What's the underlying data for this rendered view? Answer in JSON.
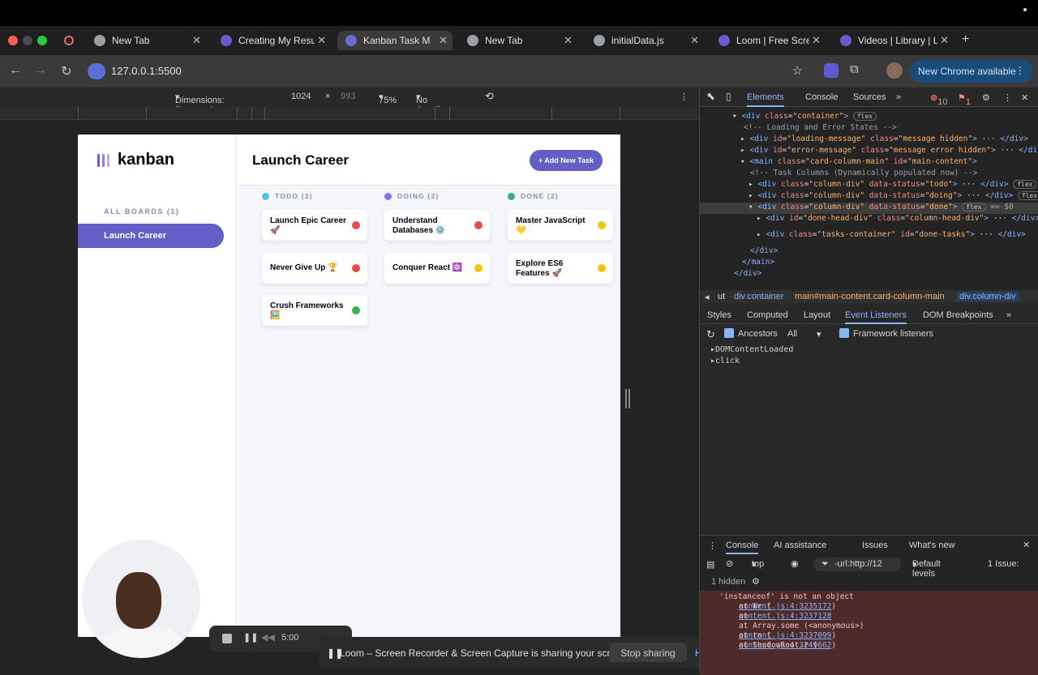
{
  "tabs": [
    {
      "label": "New Tab"
    },
    {
      "label": "Creating My Resu"
    },
    {
      "label": "Kanban Task M"
    },
    {
      "label": "New Tab"
    },
    {
      "label": "initialData.js"
    },
    {
      "label": "Loom | Free Scree"
    },
    {
      "label": "Videos | Library | L"
    }
  ],
  "address": {
    "url": "127.0.0.1:5500"
  },
  "new_chrome": "New Chrome available",
  "device_toolbar": {
    "dimensions": "Dimensions: Responsive",
    "width": "1024",
    "height": "993",
    "zoom": "75%",
    "throttle": "No throttling"
  },
  "app": {
    "logo": "kanban",
    "boards_label": "ALL BOARDS (1)",
    "board": "Launch Career",
    "title": "Launch Career",
    "add_button": "+ Add New Task",
    "columns": [
      {
        "label": "TODO (3)",
        "color": "#49c4e5",
        "cards": [
          {
            "title": "Launch Epic Career 🚀",
            "priority": "#e84b4b"
          },
          {
            "title": "Never Give Up 🏆",
            "priority": "#e84b4b"
          },
          {
            "title": "Crush Frameworks 🖼️",
            "priority": "#3bb54a"
          }
        ]
      },
      {
        "label": "DOING (2)",
        "color": "#8471f2",
        "cards": [
          {
            "title": "Understand Databases ⚙️",
            "priority": "#e84b4b"
          },
          {
            "title": "Conquer React ⚛️",
            "priority": "#f2c40f"
          }
        ]
      },
      {
        "label": "DONE (2)",
        "color": "#35a88f",
        "cards": [
          {
            "title": "Master JavaScript 💛",
            "priority": "#f2c40f"
          },
          {
            "title": "Explore ES6 Features 🚀",
            "priority": "#f2c40f"
          }
        ]
      }
    ]
  },
  "loom": {
    "timer": "5:00",
    "message": "Loom – Screen Recorder & Screen Capture is sharing your screen.",
    "stop": "Stop sharing",
    "hide": "Hide"
  },
  "devtools": {
    "tabs": [
      "Elements",
      "Console",
      "Sources"
    ],
    "errors": "10",
    "warnings": "1",
    "dom_lines": [
      {
        "text": "<div class=\"container\">",
        "badge": "flex"
      },
      {
        "text": "<!-- Loading and Error States -->"
      },
      {
        "text": "<div id=\"loading-message\" class=\"message hidden\"> ··· </div>"
      },
      {
        "text": "<div id=\"error-message\" class=\"message error hidden\"> ··· </div>"
      },
      {
        "text": "<main class=\"card-column-main\" id=\"main-content\">"
      },
      {
        "text": "<!-- Task Columns (Dynamically populated now) -->"
      },
      {
        "text": "<div class=\"column-div\" data-status=\"todo\"> ··· </div>",
        "badge": "flex"
      },
      {
        "text": "<div class=\"column-div\" data-status=\"doing\"> ··· </div>",
        "badge": "flex"
      },
      {
        "text": "<div class=\"column-div\" data-status=\"done\">",
        "badge": "flex",
        "suffix": "== $0"
      },
      {
        "text": "<div id=\"done-head-div\" class=\"column-head-div\"> ··· </div>"
      },
      {
        "text": "<div class=\"tasks-container\" id=\"done-tasks\"> ··· </div>"
      },
      {
        "text": "</div>"
      },
      {
        "text": "</main>"
      },
      {
        "text": "</div>"
      }
    ],
    "breadcrumbs": [
      "ut",
      "div.container",
      "main#main-content.card-column-main",
      "div.column-div"
    ],
    "subtabs": [
      "Styles",
      "Computed",
      "Layout",
      "Event Listeners",
      "DOM Breakpoints"
    ],
    "ancestors": "Ancestors",
    "filter": "All",
    "framework": "Framework listeners",
    "events": [
      "DOMContentLoaded",
      "click"
    ],
    "console": {
      "tabs": [
        "Console",
        "AI assistance",
        "Issues",
        "What's new"
      ],
      "context": "top",
      "filter": "-url:http://12",
      "levels": "Default levels",
      "issues": "1 Issue:",
      "hidden": "1 hidden",
      "error_lines": [
        {
          "text": "'instanceof' is not an object"
        },
        {
          "text": "at Wr (",
          "link": "content.js:4:3235172",
          "tail": ")"
        },
        {
          "text": "at ",
          "link": "content.js:4:3237128",
          "tail": ""
        },
        {
          "text": "at Array.some (<anonymous>)"
        },
        {
          "text": "at rn (",
          "link": "content.js:4:3237099",
          "tail": ")"
        },
        {
          "text": "at ShadowRoot.r (",
          "link": "content.js:4:3249662",
          "tail": ")"
        }
      ]
    }
  }
}
